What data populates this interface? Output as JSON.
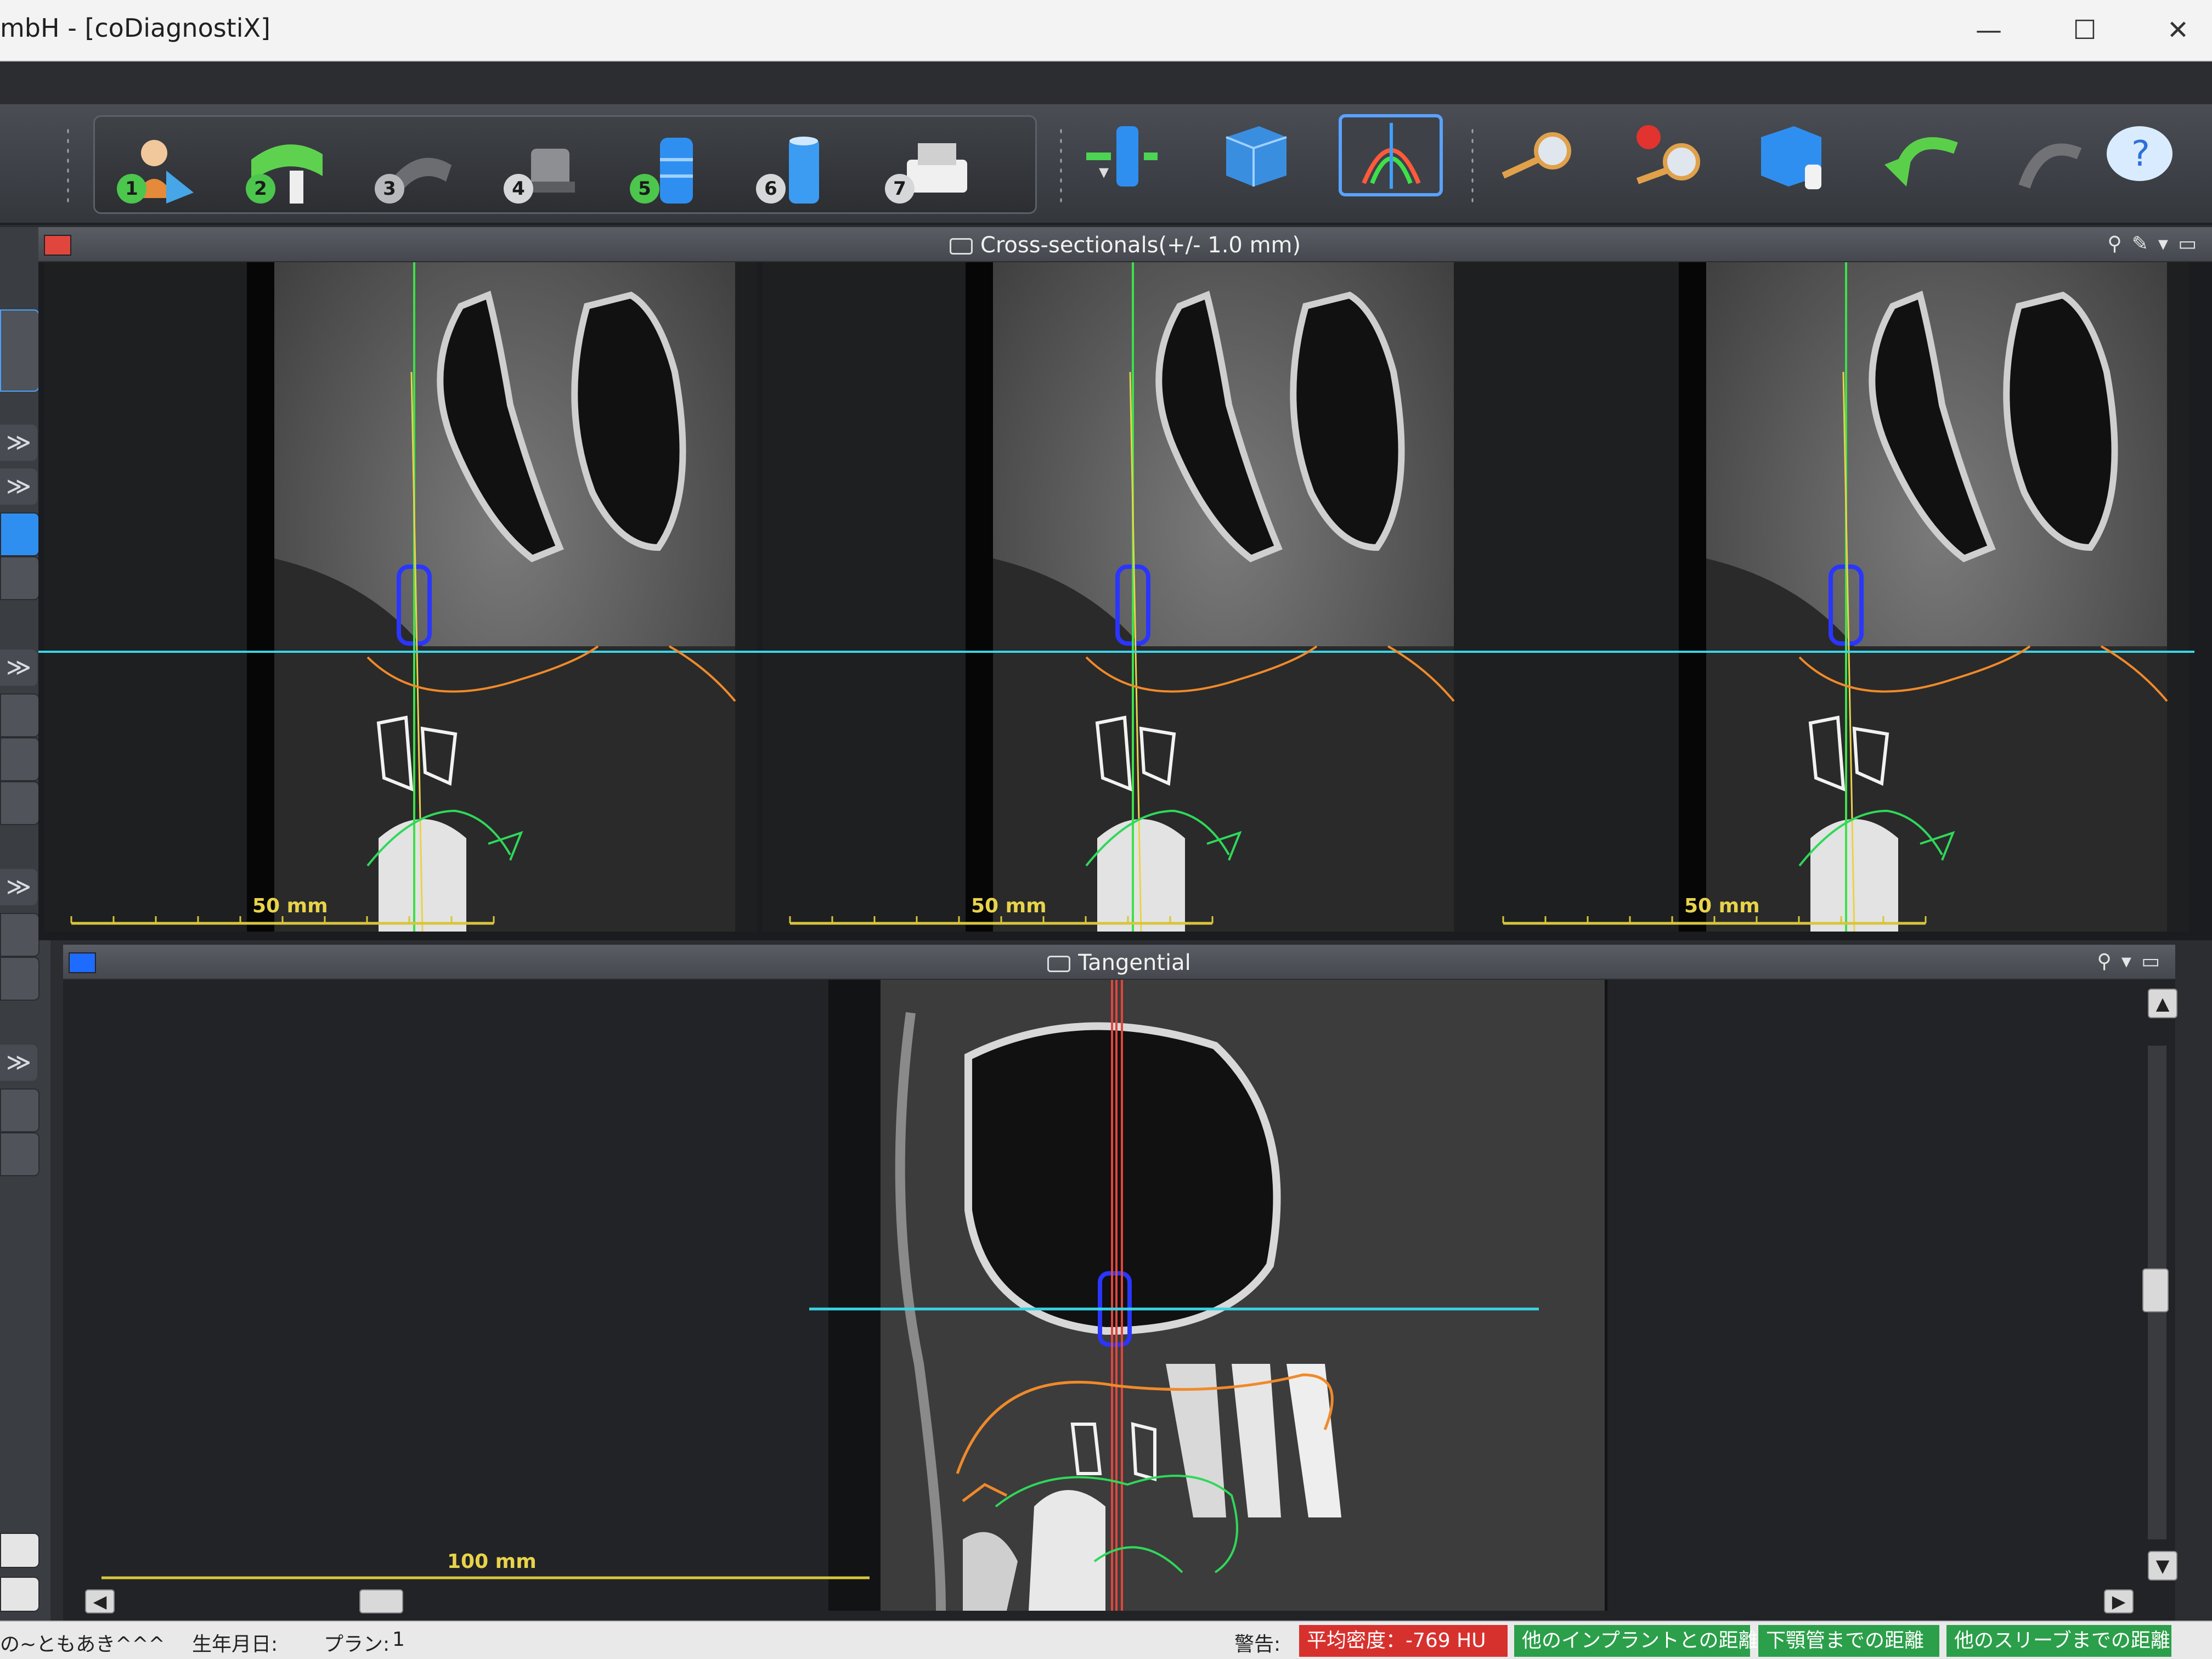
{
  "window": {
    "title": "mbH - [coDiagnostiX]",
    "minimize": "—",
    "maximize": "☐",
    "close": "✕"
  },
  "toolbar": {
    "steps": [
      "1",
      "2",
      "3",
      "4",
      "5",
      "6",
      "7"
    ],
    "dropdown": "▾"
  },
  "panels": {
    "cross": {
      "title": "Cross-sectionals(+/- 1.0 mm)",
      "icons": "⚲✎▾▭",
      "scales": [
        "50 mm",
        "50 mm",
        "50 mm"
      ]
    },
    "tangential": {
      "title": "Tangential",
      "icons": "⚲▾▭",
      "scale": "100 mm"
    }
  },
  "left_strip": {
    "chevron": "≫"
  },
  "status": {
    "patient": "の~ともあき^^^",
    "birth_label": "生年月日:",
    "plan_label": "プラン:",
    "plan_value": "1",
    "warning_label": "警告:",
    "density": "平均密度：-769 HU",
    "implant_dist": "他のインプラントとの距離",
    "canal_dist": "下顎管までの距離",
    "sleeve_dist": "他のスリーブまでの距離"
  },
  "colors": {
    "implant": "#2a36ff",
    "axis_green": "#3ee04a",
    "reference_cyan": "#39d4e6",
    "nerve_orange": "#f08a2a",
    "tooth_white": "#f2f2f2",
    "gum_green": "#2fd85a",
    "marker_red": "#d7312e",
    "marker_blue": "#1e6bff",
    "scale_yellow": "#e8d34a"
  }
}
